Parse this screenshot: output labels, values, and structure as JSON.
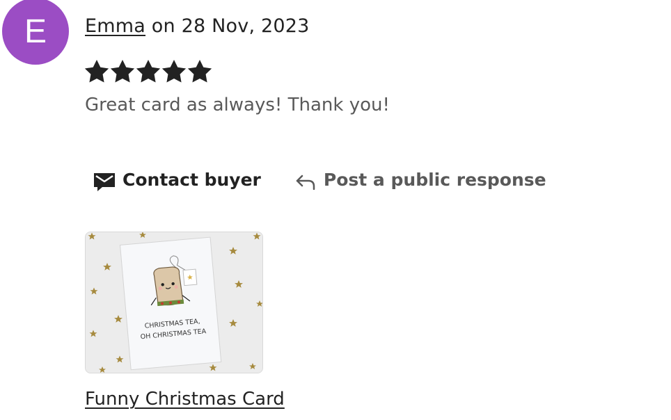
{
  "review": {
    "avatar_initial": "E",
    "avatar_color": "#9b4dc4",
    "reviewer_name": "Emma",
    "date_text": " on 28 Nov, 2023",
    "rating": 5,
    "rating_max": 5,
    "text": "Great card as always! Thank you!"
  },
  "actions": {
    "contact_label": "Contact buyer",
    "contact_icon": "envelope-icon",
    "public_label": "Post a public response",
    "public_icon": "reply-arrow-icon"
  },
  "product": {
    "card_line1": "CHRISTMAS TEA,",
    "card_line2": "OH CHRISTMAS TEA",
    "link_label": "Funny Christmas Card"
  }
}
